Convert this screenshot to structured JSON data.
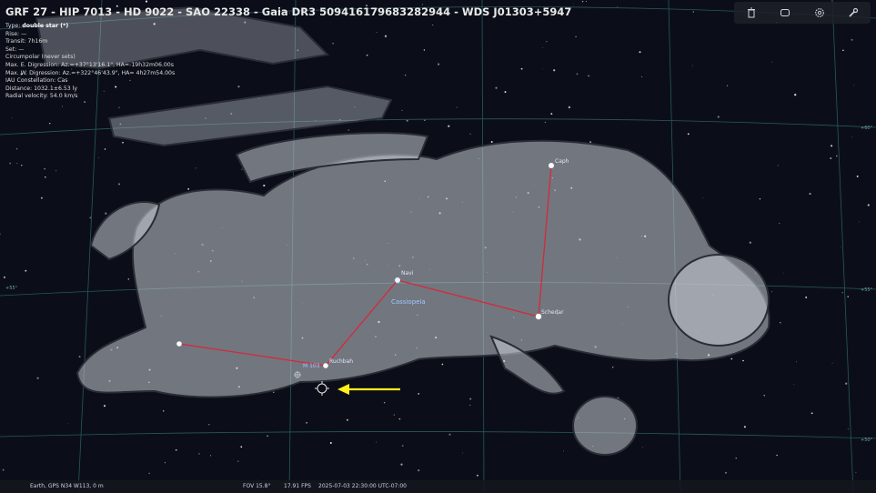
{
  "object_info": {
    "title": "GRF 27 - HIP 7013 - HD 9022 - SAO 22338 - Gaia DR3 509416179683282944 - WDS J01303+5947",
    "type_label": "Type: ",
    "type_value": "double star (*)",
    "lines": [
      "Rise: —",
      "Transit: 7h16m",
      "Set: —",
      "Circumpolar (never sets)",
      "Max. E. Digression: Az.=+37°13'16.1\", HA=-19h32m06.00s",
      "Max. W. Digression: Az.=+322°46'43.9\", HA= 4h27m54.00s",
      "IAU Constellation: Cas",
      "Distance: 1032.1±6.53 ly",
      "Radial velocity: 54.0 km/s"
    ]
  },
  "toolbar": {
    "icons": [
      "trash-icon",
      "screen-icon",
      "gear-icon",
      "wrench-icon"
    ]
  },
  "sky": {
    "constellation_name": "Cassiopeia",
    "stars": [
      {
        "name": "Caph"
      },
      {
        "name": "Navi"
      },
      {
        "name": "Schedar"
      },
      {
        "name": "Ruchbah"
      }
    ],
    "dso_label": "M 103",
    "grid_labels": {
      "dec_right_upper": "+60°",
      "dec_right_mid": "+55°",
      "dec_left_mid": "+55°",
      "dec_right_lower": "+50°"
    },
    "colors": {
      "constellation_lines": "#d42a3a",
      "grid": "#2a5f66",
      "labels": "#9fc8ff",
      "pointer_arrow": "#ffef1a"
    }
  },
  "status_bar": {
    "location": "Earth, GPS N34 W113, 0 m",
    "fov": "FOV 15.8°",
    "fps": "17.91 FPS",
    "datetime": "2025-07-03 22:30:00 UTC-07:00"
  }
}
